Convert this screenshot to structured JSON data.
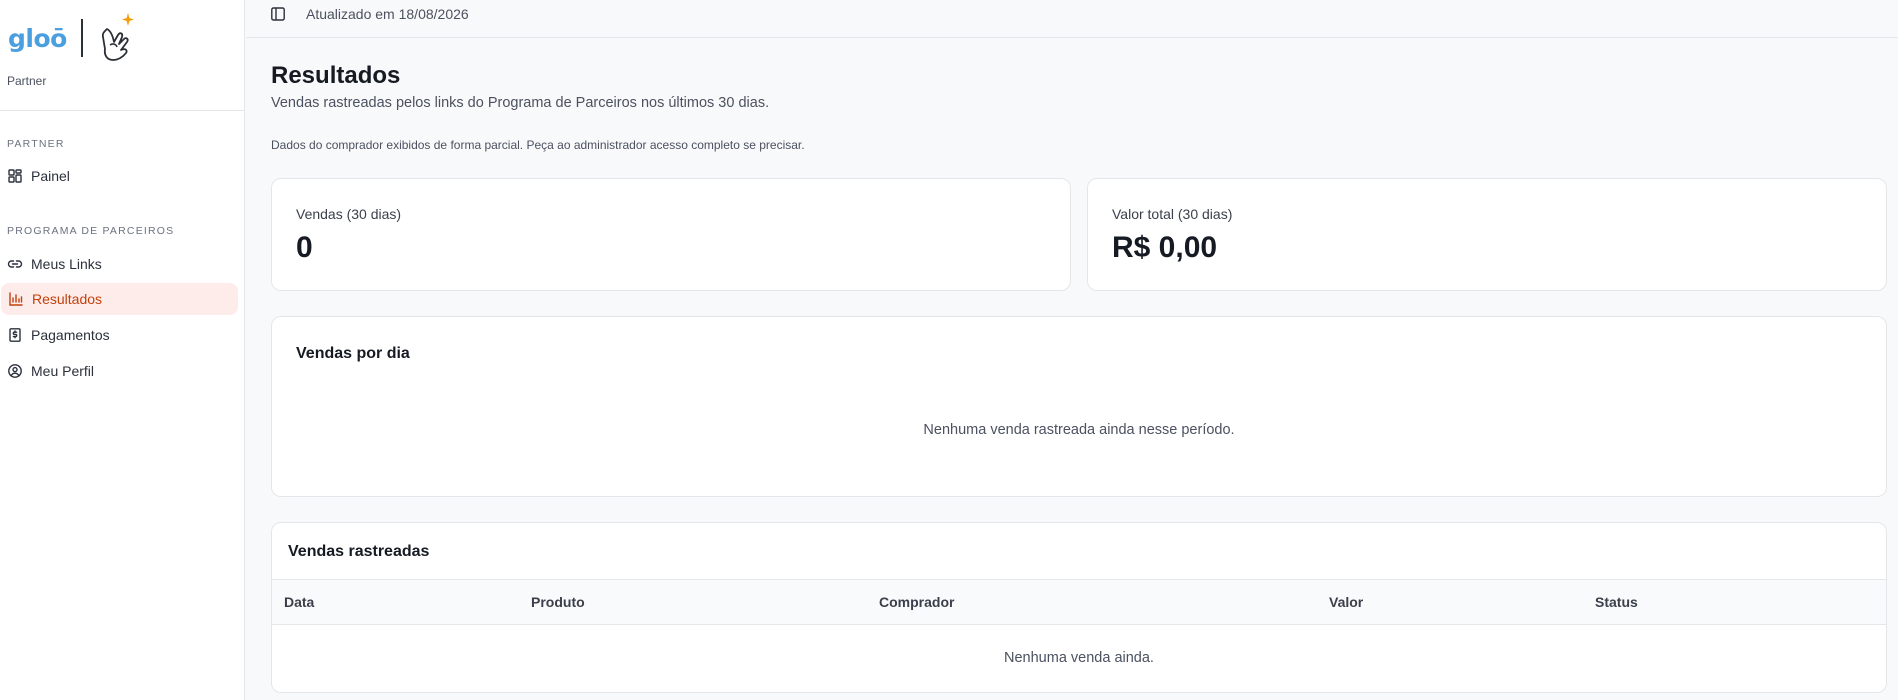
{
  "brand": {
    "logo_text": "gloō",
    "subtitle": "Partner"
  },
  "sidebar": {
    "sections": [
      {
        "title": "PARTNER",
        "items": [
          {
            "label": "Painel",
            "icon": "dashboard-icon",
            "active": false
          }
        ]
      },
      {
        "title": "PROGRAMA DE PARCEIROS",
        "items": [
          {
            "label": "Meus Links",
            "icon": "link-icon",
            "active": false
          },
          {
            "label": "Resultados",
            "icon": "bar-chart-icon",
            "active": true
          },
          {
            "label": "Pagamentos",
            "icon": "receipt-icon",
            "active": false
          },
          {
            "label": "Meu Perfil",
            "icon": "user-circle-icon",
            "active": false
          }
        ]
      }
    ],
    "active_color": "#c2410c",
    "active_bg": "#fdecea"
  },
  "topbar": {
    "updated_text": "Atualizado em 18/08/2026"
  },
  "page": {
    "title": "Resultados",
    "subtitle": "Vendas rastreadas pelos links do Programa de Parceiros nos últimos 30 dias.",
    "note": "Dados do comprador exibidos de forma parcial. Peça ao administrador acesso completo se precisar."
  },
  "stats": [
    {
      "label": "Vendas (30 dias)",
      "value": "0"
    },
    {
      "label": "Valor total (30 dias)",
      "value": "R$ 0,00"
    }
  ],
  "daily_sales": {
    "title": "Vendas por dia",
    "empty_message": "Nenhuma venda rastreada ainda nesse período."
  },
  "tracked_sales": {
    "title": "Vendas rastreadas",
    "columns": [
      "Data",
      "Produto",
      "Comprador",
      "Valor",
      "Status"
    ],
    "rows": [],
    "empty_message": "Nenhuma venda ainda."
  }
}
